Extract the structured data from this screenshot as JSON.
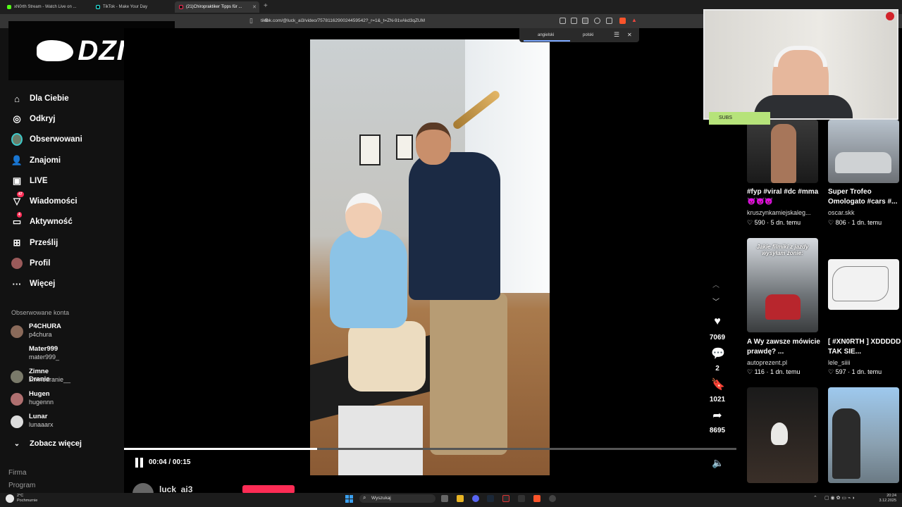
{
  "browser": {
    "tabs": [
      {
        "label": "xN0rth Stream - Watch Live on ..."
      },
      {
        "label": "TikTok - Make Your Day"
      },
      {
        "label": "(21)Chiropraktiker Tipps für ..."
      }
    ],
    "url": "tiktok.com/@luck_ai3/video/7578116290024459542?_r=1&_t=ZN-91vAkd3qZUM"
  },
  "translate": {
    "source_lang": "angielski",
    "target_lang": "polski"
  },
  "overlay": {
    "logo_text": "DZIK",
    "subs_label": "SUBS"
  },
  "sidebar": {
    "nav": [
      {
        "label": "Dla Ciebie",
        "icon": "home-icon"
      },
      {
        "label": "Odkryj",
        "icon": "compass-icon"
      },
      {
        "label": "Obserwowani",
        "icon": "following-avatar"
      },
      {
        "label": "Znajomi",
        "icon": "friends-icon"
      },
      {
        "label": "LIVE",
        "icon": "live-icon"
      },
      {
        "label": "Wiadomości",
        "icon": "messages-icon",
        "badge": "47"
      },
      {
        "label": "Aktywność",
        "icon": "activity-icon",
        "badge": "4"
      },
      {
        "label": "Prześlij",
        "icon": "upload-icon"
      },
      {
        "label": "Profil",
        "icon": "profile-avatar"
      },
      {
        "label": "Więcej",
        "icon": "more-icon"
      }
    ],
    "following_title": "Obserwowane konta",
    "accounts": [
      {
        "name": "P4CHURA",
        "handle": "p4chura"
      },
      {
        "name": "Mater999",
        "handle": "mater999_"
      },
      {
        "name": "Zimne Dranie",
        "handle": "zimnedranie__"
      },
      {
        "name": "Hugen",
        "handle": "hugennn"
      },
      {
        "name": "Lunar",
        "handle": "lunaaarx"
      }
    ],
    "see_more": "Zobacz więcej",
    "footer": [
      "Firma",
      "Program"
    ]
  },
  "player": {
    "time": "00:04 / 00:15",
    "progress": 0.315,
    "author": "luck_ai3"
  },
  "actions": {
    "likes": "7069",
    "comments": "2",
    "saves": "1021",
    "shares": "8695"
  },
  "recommendations": [
    {
      "title": "#fyp #viral #dc #mma 👿👿👿",
      "user": "kruszynkamiejskaleg...",
      "likes": "590",
      "age": "5 dn. temu"
    },
    {
      "title": "Super Trofeo Omologato #cars #...",
      "user": "oscar.skk",
      "likes": "806",
      "age": "1 dn. temu"
    },
    {
      "title": "A Wy zawsze mówicie prawdę? ...",
      "user": "autoprezent.pl",
      "likes": "116",
      "age": "1 dn. temu",
      "thumb_caption": "Jakie filmiki z jazdy wysyłam żonie:"
    },
    {
      "title": "[ #XN0RTH ] XDDDDD TAK SIE...",
      "user": "lele_siiii",
      "likes": "597",
      "age": "1 dn. temu"
    }
  ],
  "taskbar": {
    "weather_temp": "2°C",
    "weather_desc": "Pochmurnie",
    "search": "Wyszukaj",
    "time": "20:24",
    "date": "3.12.2025"
  },
  "colors": {
    "accent": "#fe2c55",
    "subs_bg": "#b6e37a",
    "sidebar_bg": "#121212"
  }
}
